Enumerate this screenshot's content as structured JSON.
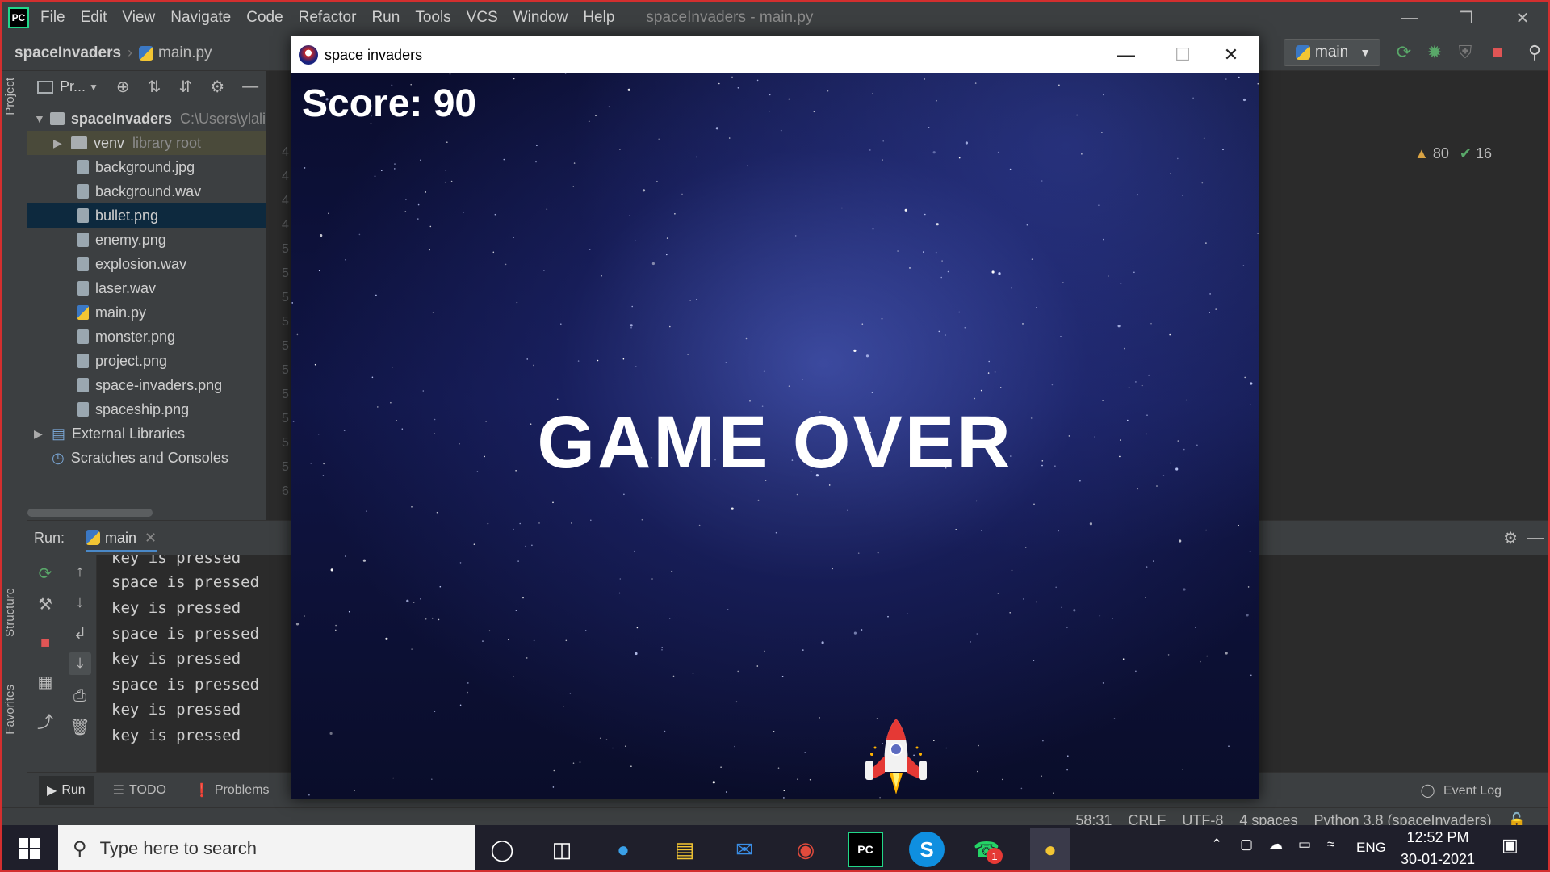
{
  "ide": {
    "menu": [
      "File",
      "Edit",
      "View",
      "Navigate",
      "Code",
      "Refactor",
      "Run",
      "Tools",
      "VCS",
      "Window",
      "Help"
    ],
    "title": "spaceInvaders - main.py",
    "breadcrumb": {
      "project": "spaceInvaders",
      "file": "main.py"
    },
    "run_config": "main",
    "inspections": {
      "warnings": "80",
      "weak_warnings": "16"
    }
  },
  "project_panel": {
    "label": "Pr...",
    "root": {
      "name": "spaceInvaders",
      "path": "C:\\Users\\ylali"
    },
    "venv": {
      "name": "venv",
      "note": "library root"
    },
    "files": [
      "background.jpg",
      "background.wav",
      "bullet.png",
      "enemy.png",
      "explosion.wav",
      "laser.wav",
      "main.py",
      "monster.png",
      "project.png",
      "space-invaders.png",
      "spaceship.png"
    ],
    "selected": "bullet.png",
    "extras": [
      "External Libraries",
      "Scratches and Consoles"
    ]
  },
  "gutter": [
    "4",
    "4",
    "4",
    "4",
    "5",
    "5",
    "5",
    "5",
    "5",
    "5",
    "5",
    "5",
    "5",
    "5",
    "6"
  ],
  "run_panel": {
    "label": "Run:",
    "tab": "main",
    "console": [
      "key is pressed",
      "space is pressed",
      "key is pressed",
      "space is pressed",
      "key is pressed",
      "space is pressed",
      "key is pressed",
      "key is pressed"
    ]
  },
  "left_stripe": {
    "project": "Project",
    "structure": "Structure",
    "favorites": "Favorites"
  },
  "bottom_tabs": {
    "run": "Run",
    "todo": "TODO",
    "problems": "Problems",
    "event_log": "Event Log"
  },
  "status": {
    "position": "58:31",
    "line_sep": "CRLF",
    "encoding": "UTF-8",
    "indent": "4 spaces",
    "interpreter": "Python 3.8 (spaceInvaders)"
  },
  "game": {
    "window_title": "space invaders",
    "score": "Score: 90",
    "message": "GAME OVER"
  },
  "taskbar": {
    "search_placeholder": "Type here to search",
    "language": "ENG",
    "time": "12:52 PM",
    "date": "30-01-2021",
    "whatsapp_badge": "1"
  },
  "colors": {
    "accent": "#4a88c7",
    "selection": "#0d293e",
    "stop_red": "#e05555",
    "run_green": "#59a869",
    "frame_red": "#d32f2f"
  }
}
